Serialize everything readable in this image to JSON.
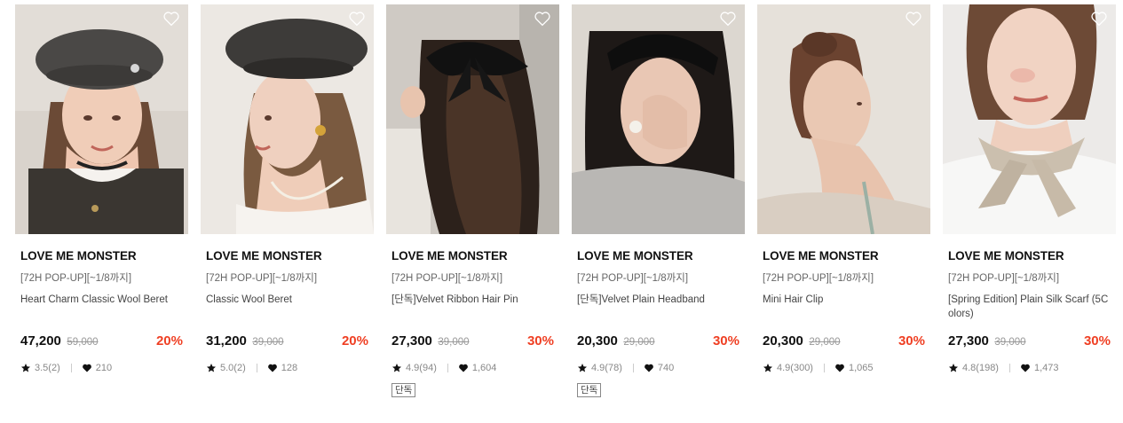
{
  "products": [
    {
      "brand": "LOVE ME MONSTER",
      "promo": "[72H POP-UP][~1/8까지]",
      "name": "Heart Charm Classic Wool Beret",
      "price": "47,200",
      "original_price": "59,000",
      "discount": "20%",
      "rating": "3.5(2)",
      "likes": "210",
      "tag": ""
    },
    {
      "brand": "LOVE ME MONSTER",
      "promo": "[72H POP-UP][~1/8까지]",
      "name": "Classic Wool Beret",
      "price": "31,200",
      "original_price": "39,000",
      "discount": "20%",
      "rating": "5.0(2)",
      "likes": "128",
      "tag": ""
    },
    {
      "brand": "LOVE ME MONSTER",
      "promo": "[72H POP-UP][~1/8까지]",
      "name": "[단독]Velvet Ribbon Hair Pin",
      "price": "27,300",
      "original_price": "39,000",
      "discount": "30%",
      "rating": "4.9(94)",
      "likes": "1,604",
      "tag": "단독"
    },
    {
      "brand": "LOVE ME MONSTER",
      "promo": "[72H POP-UP][~1/8까지]",
      "name": "[단독]Velvet Plain Headband",
      "price": "20,300",
      "original_price": "29,000",
      "discount": "30%",
      "rating": "4.9(78)",
      "likes": "740",
      "tag": "단독"
    },
    {
      "brand": "LOVE ME MONSTER",
      "promo": "[72H POP-UP][~1/8까지]",
      "name": "Mini Hair Clip",
      "price": "20,300",
      "original_price": "29,000",
      "discount": "30%",
      "rating": "4.9(300)",
      "likes": "1,065",
      "tag": ""
    },
    {
      "brand": "LOVE ME MONSTER",
      "promo": "[72H POP-UP][~1/8까지]",
      "name": "[Spring Edition] Plain Silk Scarf (5C olors)",
      "price": "27,300",
      "original_price": "39,000",
      "discount": "30%",
      "rating": "4.8(198)",
      "likes": "1,473",
      "tag": ""
    }
  ],
  "colors": {
    "discount": "#ef3f23",
    "brand_text": "#111111",
    "muted_text": "#999999"
  },
  "icons": {
    "wishlist": "heart-outline-icon",
    "rating": "star-icon",
    "likes": "heart-filled-icon"
  }
}
